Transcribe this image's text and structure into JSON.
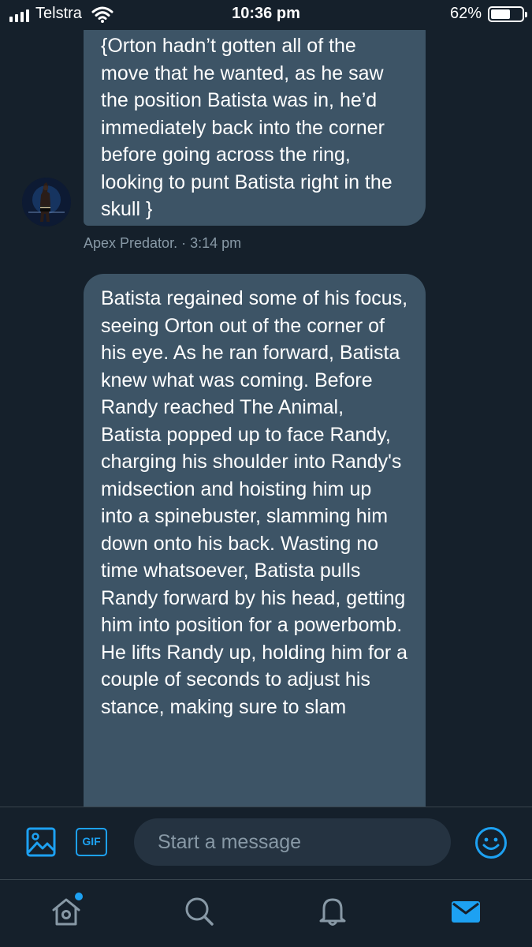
{
  "status_bar": {
    "carrier": "Telstra",
    "time": "10:36 pm",
    "battery": "62%",
    "battery_level": 0.62
  },
  "messages": [
    {
      "text": "{Orton hadn’t gotten all of the move that he wanted, as he saw the position Batista was in, he’d immediately back into the corner before going across the ring, looking to punt Batista right in the skull }",
      "sender": "Apex Predator.",
      "time": "· 3:14 pm"
    },
    {
      "text": "Batista regained some of his focus, seeing Orton out of the corner of his eye. As he ran forward, Batista knew what was coming. Before Randy reached The Animal, Batista popped up to face Randy, charging his shoulder into Randy's midsection and hoisting him up into a spinebuster, slamming him down onto his back. Wasting no time whatsoever, Batista pulls Randy forward by his head, getting him into position for a powerbomb. He lifts Randy up, holding him for a couple of seconds to adjust his stance, making sure to slam"
    }
  ],
  "composer": {
    "placeholder": "Start a message",
    "gif_label": "GIF"
  },
  "colors": {
    "background": "#15202b",
    "bubble": "#3d5466",
    "accent": "#1da1f2",
    "muted": "#8899a6"
  },
  "icons": {
    "media": "image-icon",
    "gif": "gif-icon",
    "emoji": "emoji-icon",
    "home": "home-icon",
    "search": "search-icon",
    "notifications": "bell-icon",
    "messages": "envelope-icon"
  }
}
